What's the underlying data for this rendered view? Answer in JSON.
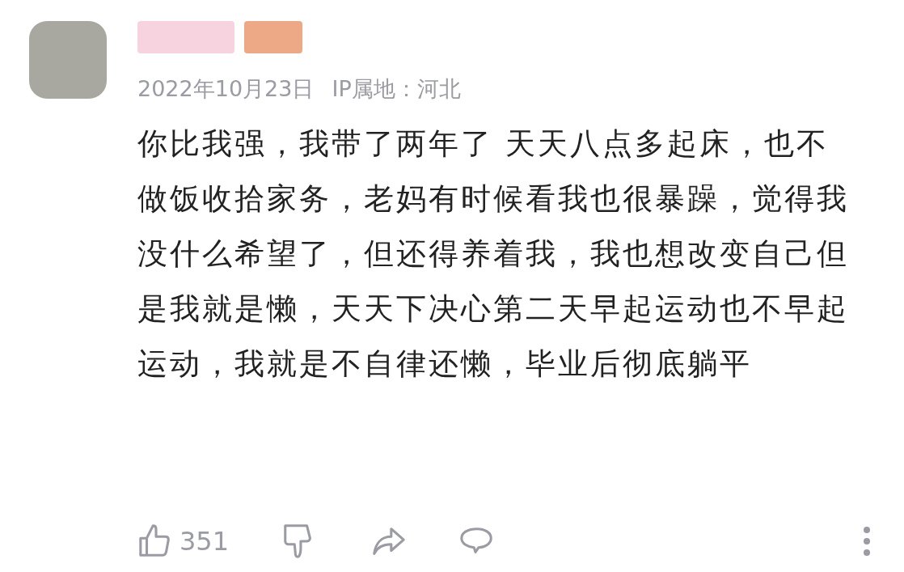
{
  "comment": {
    "date": "2022年10月23日",
    "location": "IP属地：河北",
    "body": "你比我强，我带了两年了 天天八点多起床，也不做饭收拾家务，老妈有时候看我也很暴躁，觉得我没什么希望了，但还得养着我，我也想改变自己但是我就是懒，天天下决心第二天早起运动也不早起运动，我就是不自律还懒，毕业后彻底躺平"
  },
  "actions": {
    "like_count": "351"
  }
}
